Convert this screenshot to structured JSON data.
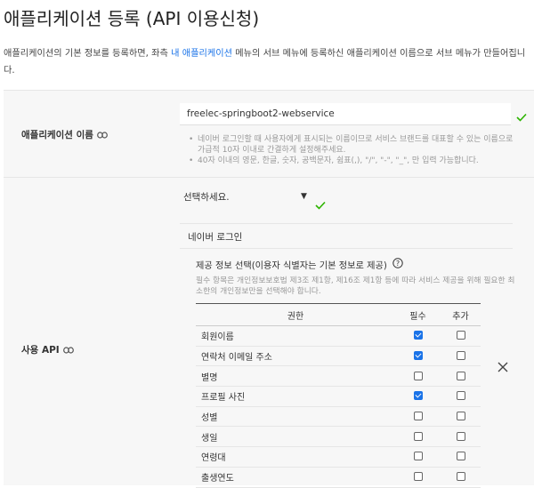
{
  "page": {
    "title": "애플리케이션 등록 (API 이용신청)",
    "desc_before": "애플리케이션의 기본 정보를 등록하면, 좌측 ",
    "desc_link": "내 애플리케이션",
    "desc_after": " 메뉴의 서브 메뉴에 등록하신 애플리케이션 이름으로 서브 메뉴가 만들어집니다."
  },
  "app_name": {
    "label": "애플리케이션 이름",
    "value": "freelec-springboot2-webservice",
    "hints": [
      "네이버 로그인할 때 사용자에게 표시되는 이름이므로 서비스 브랜드를 대표할 수 있는 이름으로 가급적 10자 이내로 간결하게 설정해주세요.",
      "40자 이내의 영문, 한글, 숫자, 공백문자, 쉼표(,), \"/\", \"-\", \"_\", 만 입력 가능합니다."
    ]
  },
  "api": {
    "label": "사용 API",
    "select_value": "선택하세요.",
    "selected_api": "네이버 로그인",
    "scope_title": "제공 정보 선택(이용자 식별자는 기본 정보로 제공)",
    "scope_note": "필수 항목은 개인정보보호법 제3조 제1항, 제16조 제1항 등에 따라 서비스 제공을 위해 필요한 최소한의 개인정보만을 선택해야 합니다.",
    "table": {
      "headers": [
        "권한",
        "필수",
        "추가"
      ],
      "rows": [
        {
          "name": "회원이름",
          "required": true,
          "extra": false
        },
        {
          "name": "연락처 이메일 주소",
          "required": true,
          "extra": false
        },
        {
          "name": "별명",
          "required": false,
          "extra": false
        },
        {
          "name": "프로필 사진",
          "required": true,
          "extra": false
        },
        {
          "name": "성별",
          "required": false,
          "extra": false
        },
        {
          "name": "생일",
          "required": false,
          "extra": false
        },
        {
          "name": "연령대",
          "required": false,
          "extra": false
        },
        {
          "name": "출생연도",
          "required": false,
          "extra": false
        }
      ]
    }
  },
  "colors": {
    "accent": "#1a73e8",
    "valid_check": "#2db400"
  }
}
